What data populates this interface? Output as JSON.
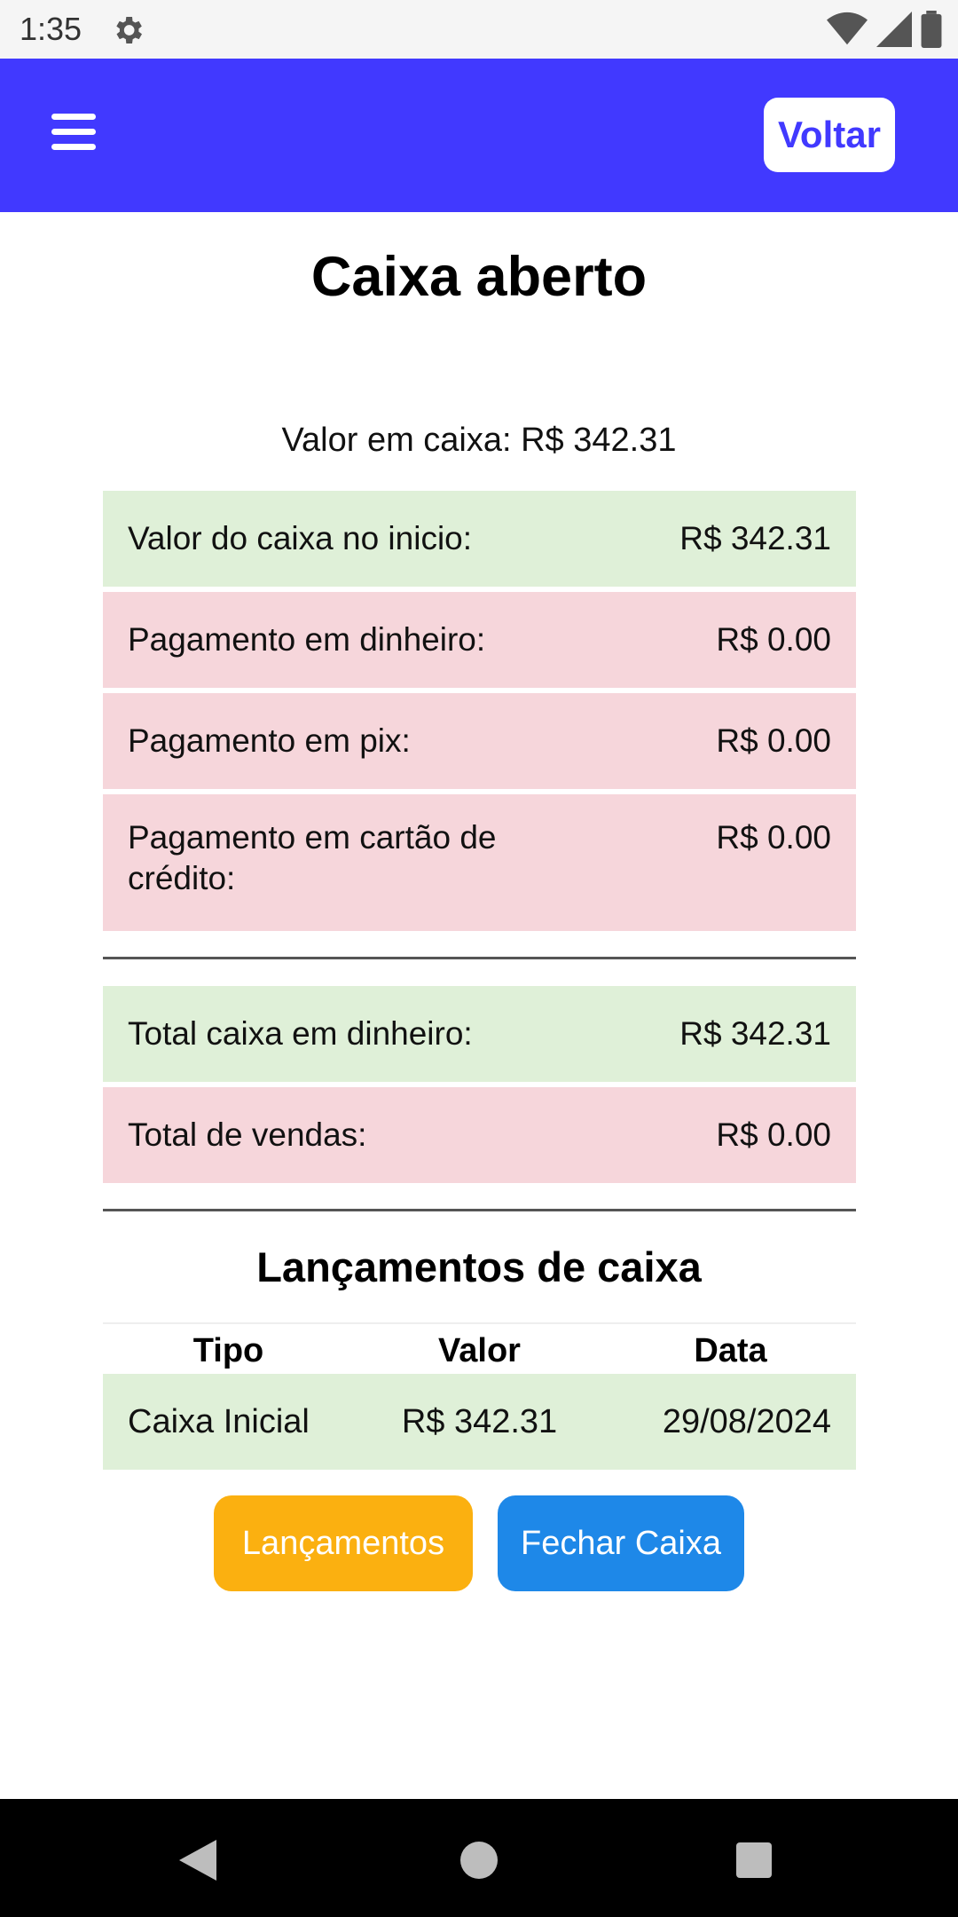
{
  "status_bar": {
    "time": "1:35"
  },
  "app_bar": {
    "back_label": "Voltar"
  },
  "page": {
    "title": "Caixa aberto",
    "cash_line": "Valor em caixa: R$ 342.31"
  },
  "summary_rows": [
    {
      "label": "Valor do caixa no inicio:",
      "value": "R$ 342.31",
      "color": "#dff0d8"
    },
    {
      "label": "Pagamento em dinheiro:",
      "value": "R$ 0.00",
      "color": "#f6d6db"
    },
    {
      "label": "Pagamento em pix:",
      "value": "R$ 0.00",
      "color": "#f6d6db"
    },
    {
      "label": "Pagamento em cartão de crédito:",
      "value": "R$ 0.00",
      "color": "#f6d6db"
    }
  ],
  "totals_rows": [
    {
      "label": "Total caixa em dinheiro:",
      "value": "R$ 342.31",
      "color": "#dff0d8"
    },
    {
      "label": "Total de vendas:",
      "value": "R$ 0.00",
      "color": "#f6d6db"
    }
  ],
  "entries": {
    "title": "Lançamentos de caixa",
    "columns": [
      "Tipo",
      "Valor",
      "Data"
    ],
    "rows": [
      {
        "tipo": "Caixa Inicial",
        "valor": "R$ 342.31",
        "data": "29/08/2024"
      }
    ]
  },
  "buttons": {
    "entries_label": "Lançamentos",
    "close_label": "Fechar Caixa"
  },
  "colors": {
    "app_bar": "#4139ff",
    "green_row": "#dff0d8",
    "red_row": "#f6d6db",
    "orange_button": "#fbb010",
    "blue_button": "#1e88e8"
  },
  "icons": {
    "status_left": "gear-icon",
    "status_right": [
      "wifi-icon",
      "signal-icon",
      "battery-icon"
    ],
    "app_bar_left": "hamburger-menu-icon",
    "nav": [
      "back-triangle-icon",
      "home-circle-icon",
      "recents-square-icon"
    ]
  }
}
